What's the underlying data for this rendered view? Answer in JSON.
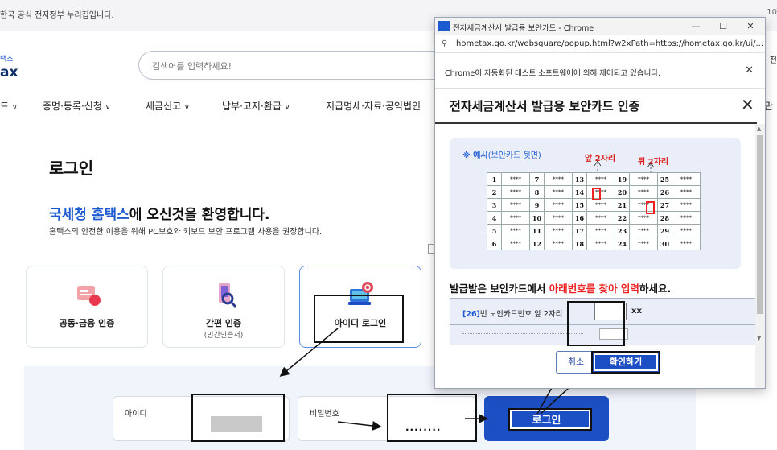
{
  "background": {
    "gov_banner": "한국 공식 전자정부 누리집입니다.",
    "banner_edge": "10",
    "logo_top": "택스",
    "logo_bottom": "ax",
    "search_placeholder": "검색어를 입력하세요!",
    "right_edge_text": "전",
    "right_edge_nav": "관",
    "nav_items": [
      {
        "label": "드"
      },
      {
        "label": "증명·등록·신청"
      },
      {
        "label": "세금신고"
      },
      {
        "label": "납부·고지·환급"
      },
      {
        "label": "지급명세·자료·공익법인"
      }
    ],
    "page_title": "로그인",
    "welcome_brand": "국세청 홈택스",
    "welcome_rest": "에 오신것을 환영합니다.",
    "welcome_sub": "홈택스의 안전한 이용을 위해 PC보호와 키보드 보안 프로그램 사용을 권장합니다.",
    "auth_options": [
      {
        "label": "공동·금융 인증",
        "sub": ""
      },
      {
        "label": "간편 인증",
        "sub": "(민간인증서)"
      },
      {
        "label": "아이디 로그인",
        "sub": ""
      }
    ],
    "id_label": "아이디",
    "pw_label": "비밀번호",
    "pw_dots": "........",
    "login_button": "로그인"
  },
  "popup": {
    "window_title": "전자세금계산서 발급용 보안카드 - Chrome",
    "url": "hometax.go.kr/websquare/popup.html?w2xPath=https://hometax.go.kr/ui/...",
    "info_message": "Chrome이 자동화된 테스트 소프트웨어에 의해 제어되고 있습니다.",
    "dialog_title": "전자세금계산서 발급용 보안카드 인증",
    "example_label": "※ 예시",
    "example_paren": "(보안카드 뒷면)",
    "front_digits": "앞 2자리",
    "back_digits": "뒤 2자리",
    "card_rows": [
      [
        "1",
        "****",
        "7",
        "****",
        "13",
        "****",
        "19",
        "****",
        "25",
        "****"
      ],
      [
        "2",
        "****",
        "8",
        "****",
        "14",
        "****",
        "20",
        "****",
        "26",
        "****"
      ],
      [
        "3",
        "****",
        "9",
        "****",
        "15",
        "****",
        "21",
        "****",
        "27",
        "****"
      ],
      [
        "4",
        "****",
        "10",
        "****",
        "16",
        "****",
        "22",
        "****",
        "28",
        "****"
      ],
      [
        "5",
        "****",
        "11",
        "****",
        "17",
        "****",
        "23",
        "****",
        "29",
        "****"
      ],
      [
        "6",
        "****",
        "12",
        "****",
        "18",
        "****",
        "24",
        "****",
        "30",
        "****"
      ]
    ],
    "instruction_a": "발급받은 보안카드에서 ",
    "instruction_red": "아래번호를 찾아 입력",
    "instruction_b": "하세요.",
    "row_num": "[26]",
    "row_label": "번 보안카드번호 앞 2자리",
    "row_suffix": "xx",
    "cancel_button": "취소",
    "confirm_button": "확인하기"
  }
}
